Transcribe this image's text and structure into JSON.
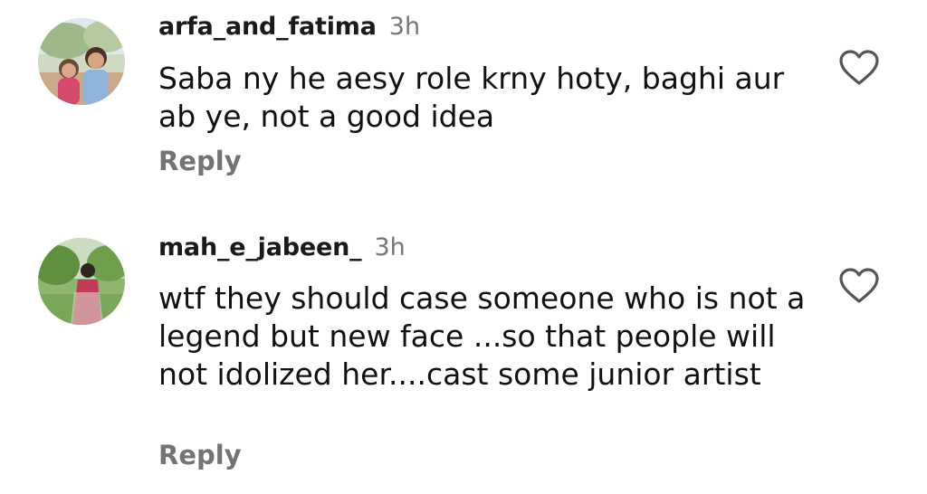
{
  "comments": [
    {
      "username": "arfa_and_fatima",
      "time": "3h",
      "text": "Saba ny he aesy role krny hoty, baghi aur ab ye, not a good idea",
      "reply_label": "Reply",
      "like_icon": "heart-outline-icon"
    },
    {
      "username": "mah_e_jabeen_",
      "time": "3h",
      "text": "wtf they should case someone who is not a legend but new face ...so that people will not idolized her....cast some junior artist",
      "reply_label": "Reply",
      "like_icon": "heart-outline-icon"
    }
  ],
  "colors": {
    "text": "#111111",
    "muted": "#737373",
    "background": "#ffffff"
  }
}
